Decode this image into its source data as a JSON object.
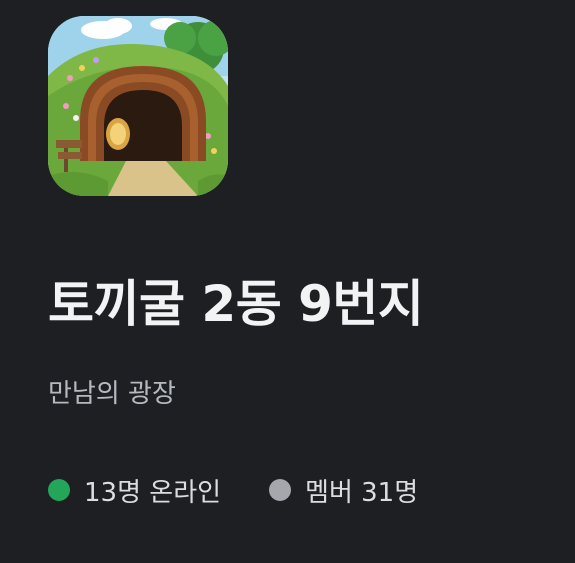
{
  "server": {
    "name": "토끼굴 2동 9번지",
    "description": "만남의 광장",
    "icon": "rabbit-hole-door-icon"
  },
  "stats": {
    "online_label": "13명 온라인",
    "online_color": "#23a55a",
    "members_label": "멤버 31명",
    "members_color": "#a5a7ad"
  },
  "theme": {
    "background": "#1e1f22",
    "title_color": "#f2f3f5",
    "subtitle_color": "#b5bac1"
  }
}
